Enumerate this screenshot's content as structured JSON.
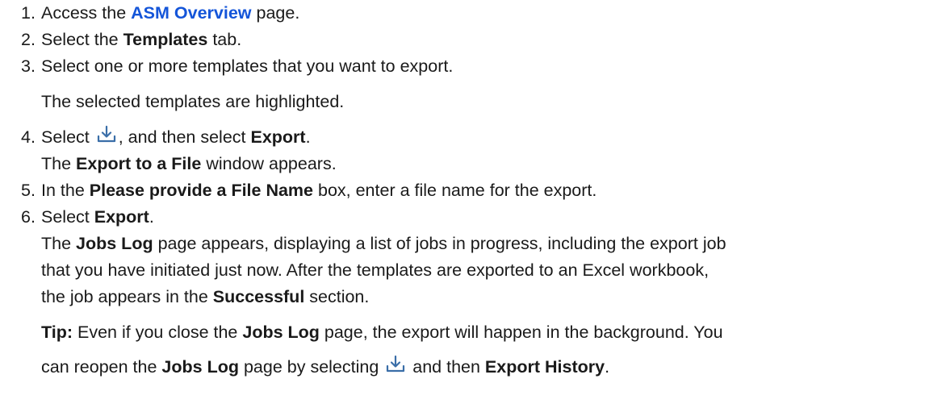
{
  "steps": [
    {
      "num": "1.",
      "pre": "Access the ",
      "link": "ASM Overview",
      "post": " page."
    },
    {
      "num": "2.",
      "pre": "Select the ",
      "bold": "Templates",
      "post": " tab."
    },
    {
      "num": "3.",
      "text": "Select one or more templates that you want to export.",
      "note": "The selected templates are highlighted."
    },
    {
      "num": "4.",
      "pre": "Select ",
      "mid": ", and then select ",
      "bold": "Export",
      "post": ".",
      "line2_pre": "The ",
      "line2_bold": "Export to a File",
      "line2_post": " window appears."
    },
    {
      "num": "5.",
      "pre": "In the ",
      "bold": "Please provide a File Name",
      "post": " box, enter a file name for the export."
    },
    {
      "num": "6.",
      "pre": "Select ",
      "bold": "Export",
      "post": ".",
      "l2_pre": "The ",
      "l2_bold": "Jobs Log",
      "l2_post": " page appears, displaying a list of jobs in progress, including the export job",
      "l3": "that you have initiated just now. After the templates are exported to an Excel workbook,",
      "l4_pre": "the job appears in the ",
      "l4_bold": "Successful",
      "l4_post": " section."
    }
  ],
  "tip": {
    "label": "Tip:",
    "t1": " Even if you close the ",
    "b1": "Jobs Log",
    "t2": " page, the export will happen in the background. You",
    "t3": "can reopen the ",
    "b2": "Jobs Log",
    "t4": " page by selecting ",
    "t5": " and then ",
    "b3": "Export History",
    "t6": "."
  },
  "icons": {
    "export": "download-tray-icon",
    "color": "#3a6ea8"
  }
}
